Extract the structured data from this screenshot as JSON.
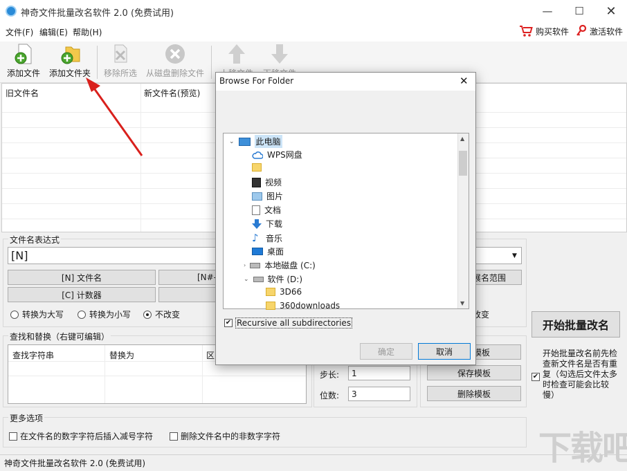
{
  "window": {
    "title": "神奇文件批量改名软件 2.0 (免费试用)"
  },
  "menu": {
    "file": "文件(F)",
    "edit": "编辑(E)",
    "help": "帮助(H)",
    "buy": "购买软件",
    "activate": "激活软件"
  },
  "toolbar": {
    "add_file": "添加文件",
    "add_folder": "添加文件夹",
    "remove_selected": "移除所选",
    "delete_from_disk": "从磁盘删除文件",
    "move_up": "上移文件",
    "move_down": "下移文件"
  },
  "list": {
    "col_old": "旧文件名",
    "col_new": "新文件名(预览)"
  },
  "expression": {
    "section_title": "文件名表达式",
    "value": "[N]",
    "btn_name": "[N] 文件名",
    "btn_name_part": "[N#-",
    "btn_counter": "[C] 计数器",
    "ext_range": "展名范围",
    "opt_upper": "转换为大写",
    "opt_lower": "转换为小写",
    "opt_nochange": "不改变",
    "opt_nochange2": "改变"
  },
  "find_replace": {
    "section_title": "查找和替换（右键可编辑）",
    "col_find": "查找字符串",
    "col_replace": "替换为",
    "col_third": "区"
  },
  "counter": {
    "step_label": "步长:",
    "step_value": "1",
    "digits_label": "位数:",
    "digits_value": "3"
  },
  "templates": {
    "load": "模板",
    "save": "保存模板",
    "delete": "删除模板"
  },
  "start": {
    "button": "开始批量改名",
    "check_text_1": "开始批量改名前先检",
    "check_text_2": "查新文件名是否有重",
    "check_text_3": "复（勾选后文件太多",
    "check_text_4": "时检查可能会比较",
    "check_text_5": "慢）"
  },
  "more": {
    "section_title": "更多选项",
    "opt_insert_minus": "在文件名的数字字符后插入减号字符",
    "opt_remove_nondigit": "删除文件名中的非数字字符"
  },
  "statusbar": {
    "text": "神奇文件批量改名软件 2.0 (免费试用)"
  },
  "dialog": {
    "title": "Browse For Folder",
    "tree": [
      "此电脑",
      "WPS网盘",
      "",
      "视频",
      "图片",
      "文档",
      "下载",
      "音乐",
      "桌面",
      "本地磁盘 (C:)",
      "软件 (D:)",
      "3D66",
      "360downloads"
    ],
    "recursive_label": "Recursive all subdirectories",
    "ok": "确定",
    "cancel": "取消"
  },
  "watermark": {
    "text": "下载吧"
  }
}
